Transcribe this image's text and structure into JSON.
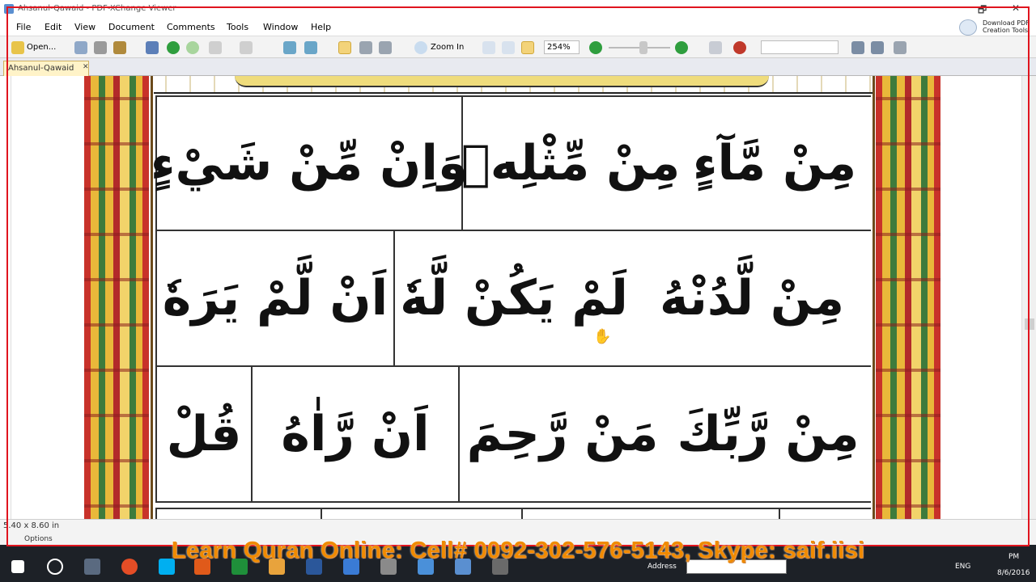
{
  "window": {
    "title": "Ahsanul-Qawaid - PDF-XChange Viewer",
    "controls": [
      "🗗",
      "✕"
    ]
  },
  "menu": {
    "items": [
      "File",
      "Edit",
      "View",
      "Document",
      "Comments",
      "Tools",
      "Window",
      "Help"
    ]
  },
  "toolbar": {
    "open_label": "Open...",
    "zoom_in_label": "Zoom In",
    "zoom_value": "254%",
    "promo_line1": "Download PDF",
    "promo_line2": "Creation Tools"
  },
  "tabs": {
    "document_tab": "Ahsanul-Qawaid",
    "close_glyph": "✕"
  },
  "page": {
    "rows": [
      {
        "cells": [
          "مِنْ مَّآءٍ",
          "مِنْ مِّثْلِهٖ",
          "وَاِنْ مِّنْ شَيْءٍ"
        ]
      },
      {
        "cells": [
          "مِنْ لَّدُنْهُ",
          "لَمْ يَكُنْ لَّهٗ",
          "اَنْ لَّمْ يَرَهٗ"
        ]
      },
      {
        "cells": [
          "مِنْ رَّبِّكَ",
          "مَنْ رَّحِمَ",
          "اَنْ رَّاٰهُ",
          "قُلْ"
        ]
      }
    ]
  },
  "status": {
    "page_size": "5.40 x 8.60 in",
    "options_label": "Options"
  },
  "taskbar": {
    "address_label": "Address",
    "language": "ENG",
    "time": "PM",
    "date": "8/6/2016"
  },
  "overlay": {
    "promo_text": "Learn Quran Online: Cell# 0092-302-576-5143, Skype: saif.iisi",
    "frame_color": "#e0141e",
    "promo_color": "#f08a00"
  }
}
